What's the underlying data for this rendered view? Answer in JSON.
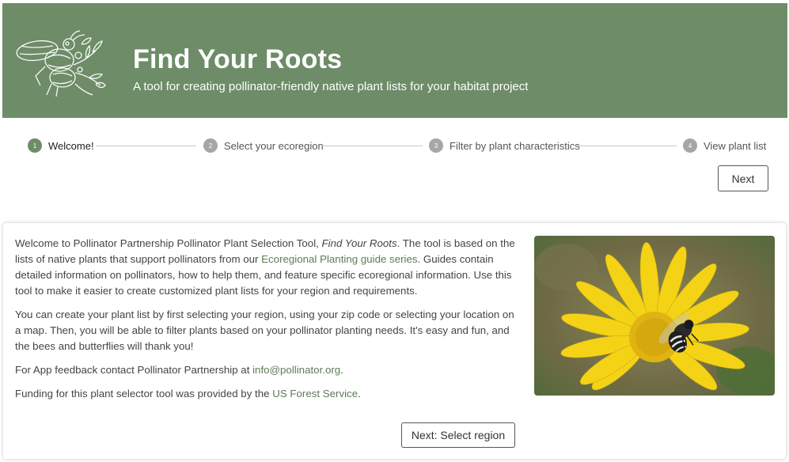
{
  "header": {
    "title": "Find Your Roots",
    "subtitle": "A tool for creating pollinator-friendly native plant lists for your habitat project",
    "logo_icon": "bee-floral-illustration-icon",
    "background": "#6d8c67"
  },
  "stepper": {
    "steps": [
      {
        "number": "1",
        "label": "Welcome!"
      },
      {
        "number": "2",
        "label": "Select your ecoregion"
      },
      {
        "number": "3",
        "label": "Filter by plant characteristics"
      },
      {
        "number": "4",
        "label": "View plant list"
      }
    ],
    "active_step": 1,
    "next_label": "Next"
  },
  "main": {
    "intro_before": "Welcome to Pollinator Partnership Pollinator Plant Selection Tool, ",
    "intro_italic": "Find Your Roots",
    "intro_after_italic": ". The tool is based on the lists of native plants that support pollinators from our ",
    "ecoregional_link": "Ecoregional Planting guide series",
    "intro_after_link": ". Guides contain detailed information on pollinators, how to help them, and feature specific ecoregional information. Use this tool to make it easier to create customized plant lists for your region and requirements.",
    "paragraph2": "You can create your plant list by first selecting your region, using your zip code or selecting your location on a map. Then, you will be able to filter plants based on your pollinator planting needs. It's easy and fun, and the bees and butterflies will thank you!",
    "feedback_before": "For App feedback contact Pollinator Partnership at ",
    "feedback_email": "info@pollinator.org",
    "feedback_after": ".",
    "funding_before": "Funding for this plant selector tool was provided by the ",
    "funding_link": "US Forest Service",
    "funding_after": ".",
    "photo_icon": "bee-on-yellow-flower-photo",
    "select_region_label": "Next: Select region"
  },
  "colors": {
    "accent": "#6d8c67",
    "link": "#5d7c57",
    "inactive_step": "#a6a6a6"
  }
}
